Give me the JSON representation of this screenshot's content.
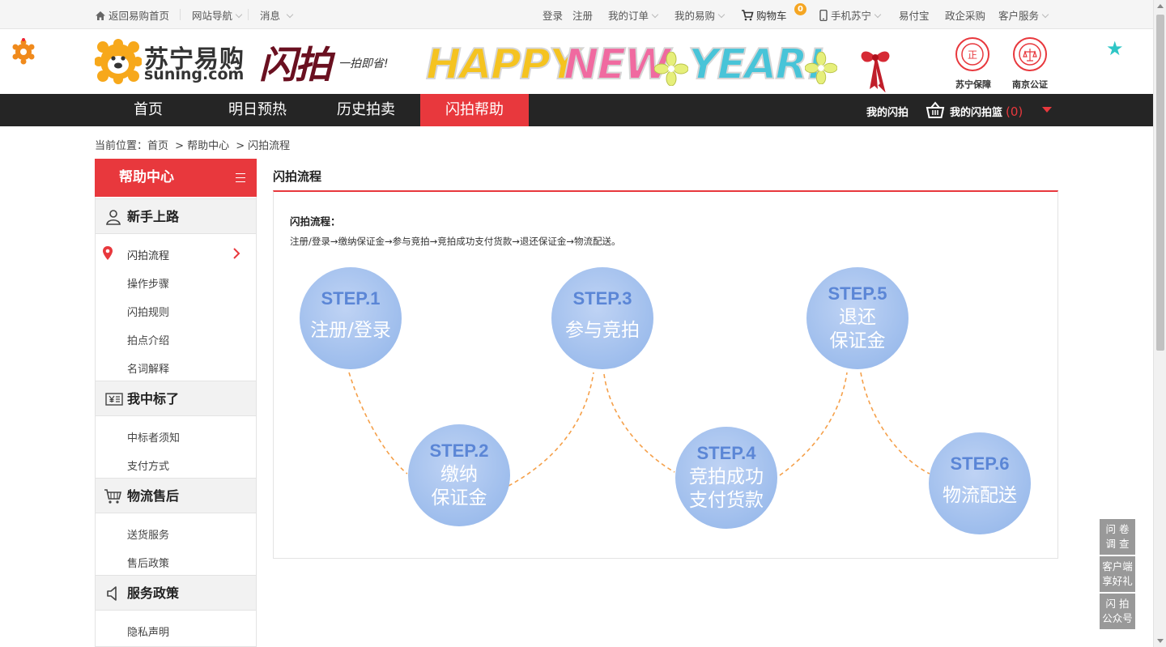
{
  "topbar": {
    "home_link": "返回易购首页",
    "site_nav": "网站导航",
    "messages": "消息",
    "login": "登录",
    "register": "注册",
    "my_orders": "我的订单",
    "my_yigou": "我的易购",
    "cart": "购物车",
    "cart_count": "0",
    "mobile": "手机苏宁",
    "yifubao": "易付宝",
    "gov_purchase": "政企采购",
    "customer_service": "客户服务"
  },
  "header": {
    "brand_name": "苏宁易购",
    "brand_url": "suning.com",
    "flash_logo": "闪拍",
    "flash_slogan": "一拍即省!",
    "banner_words": [
      "HAPPY",
      "NEW",
      "YEAR!"
    ],
    "badge_guarantee": "苏宁保障",
    "badge_notary": "南京公证"
  },
  "nav": {
    "items": [
      "首页",
      "明日预热",
      "历史拍卖",
      "闪拍帮助"
    ],
    "active_index": 3,
    "my_bids": "我的闪拍",
    "my_basket": "我的闪拍篮",
    "basket_count": "(0)"
  },
  "breadcrumb": {
    "prefix": "当前位置：",
    "home": "首页",
    "help": "帮助中心",
    "current": "闪拍流程",
    "separator": ">"
  },
  "sidebar": {
    "title": "帮助中心",
    "groups": [
      {
        "label": "新手上路",
        "icon": "user-icon",
        "items": [
          "闪拍流程",
          "操作步骤",
          "闪拍规则",
          "拍点介绍",
          "名词解释"
        ]
      },
      {
        "label": "我中标了",
        "icon": "receipt-icon",
        "items": [
          "中标者须知",
          "支付方式"
        ]
      },
      {
        "label": "物流售后",
        "icon": "cart-icon",
        "items": [
          "送货服务",
          "售后政策"
        ]
      },
      {
        "label": "服务政策",
        "icon": "speaker-icon",
        "items": [
          "隐私声明"
        ]
      }
    ],
    "active_item": "闪拍流程"
  },
  "main": {
    "title": "闪拍流程",
    "process_title": "闪拍流程：",
    "process_desc": "注册/登录→缴纳保证金→参与竞拍→竞拍成功支付货款→退还保证金→物流配送。",
    "steps": [
      {
        "step": "STEP.1",
        "lines": [
          "注册/登录"
        ]
      },
      {
        "step": "STEP.2",
        "lines": [
          "缴纳",
          "保证金"
        ]
      },
      {
        "step": "STEP.3",
        "lines": [
          "参与竞拍"
        ]
      },
      {
        "step": "STEP.4",
        "lines": [
          "竞拍成功",
          "支付货款"
        ]
      },
      {
        "step": "STEP.5",
        "lines": [
          "退还",
          "保证金"
        ]
      },
      {
        "step": "STEP.6",
        "lines": [
          "物流配送"
        ]
      }
    ]
  },
  "floating": {
    "survey": [
      "问 卷",
      "调 查"
    ],
    "app_gift": [
      "客户端",
      "享好礼"
    ],
    "wechat": [
      "闪 拍",
      "公众号"
    ]
  },
  "colors": {
    "accent": "#e8383d",
    "nav_bg": "#252525",
    "step_circle": "#a9c4ee",
    "dash": "#f5a04a",
    "badge": "#f5a623"
  }
}
